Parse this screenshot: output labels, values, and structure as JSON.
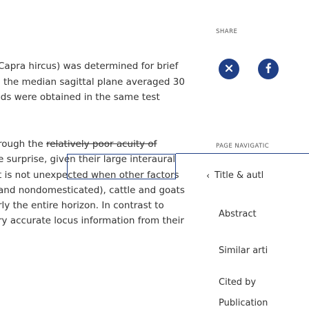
{
  "article": {
    "lines": [
      "Capra hircus) was determined for brief",
      "l the median sagittal plane averaged 30",
      "lds were obtained in the same test",
      "rough the relatively poor acuity of",
      "e surprise, given their large interaural",
      "t is not unexpected when other factors",
      "and nondomesticated), cattle and goats",
      "rly the entire horizon. In contrast to",
      "ry accurate locus information from their"
    ],
    "line4_prefix": "rough the ",
    "line4_struck": "relatively poor acuity of"
  },
  "share": {
    "label": "SHARE",
    "buttons": [
      {
        "name": "email",
        "icon": "close-icon"
      },
      {
        "name": "facebook",
        "icon": "facebook-icon"
      }
    ]
  },
  "page_nav": {
    "label": "PAGE NAVIGATIC",
    "items": [
      {
        "label": "Title & autl",
        "active": true
      },
      {
        "label": "Abstract"
      },
      {
        "label": "Similar arti"
      },
      {
        "label": "Cited by"
      },
      {
        "label": "Publication"
      }
    ]
  },
  "colors": {
    "accent": "#1f3f86",
    "text": "#333333"
  }
}
